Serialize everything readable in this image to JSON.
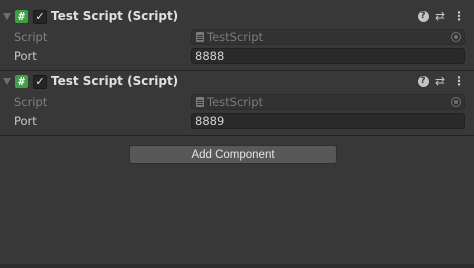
{
  "components": [
    {
      "title": "Test Script (Script)",
      "enabled_glyph": "✓",
      "script_icon_glyph": "#",
      "properties": {
        "script_label": "Script",
        "script_value": "TestScript",
        "port_label": "Port",
        "port_value": "8888"
      }
    },
    {
      "title": "Test Script (Script)",
      "enabled_glyph": "✓",
      "script_icon_glyph": "#",
      "properties": {
        "script_label": "Script",
        "script_value": "TestScript",
        "port_label": "Port",
        "port_value": "8889"
      }
    }
  ],
  "header_buttons": {
    "help_glyph": "?",
    "presets_glyph": "⇄",
    "menu_glyph": "⋮"
  },
  "add_component_label": "Add Component",
  "icons": [
    "foldout-arrow-icon",
    "csharp-script-icon",
    "checkbox-check-icon",
    "help-icon",
    "presets-icon",
    "context-menu-icon",
    "script-file-icon",
    "object-picker-icon"
  ],
  "colors": {
    "background": "#383838",
    "script_icon": "#3aa43f",
    "field_background": "#2a2a2a",
    "button_background": "#585858"
  }
}
